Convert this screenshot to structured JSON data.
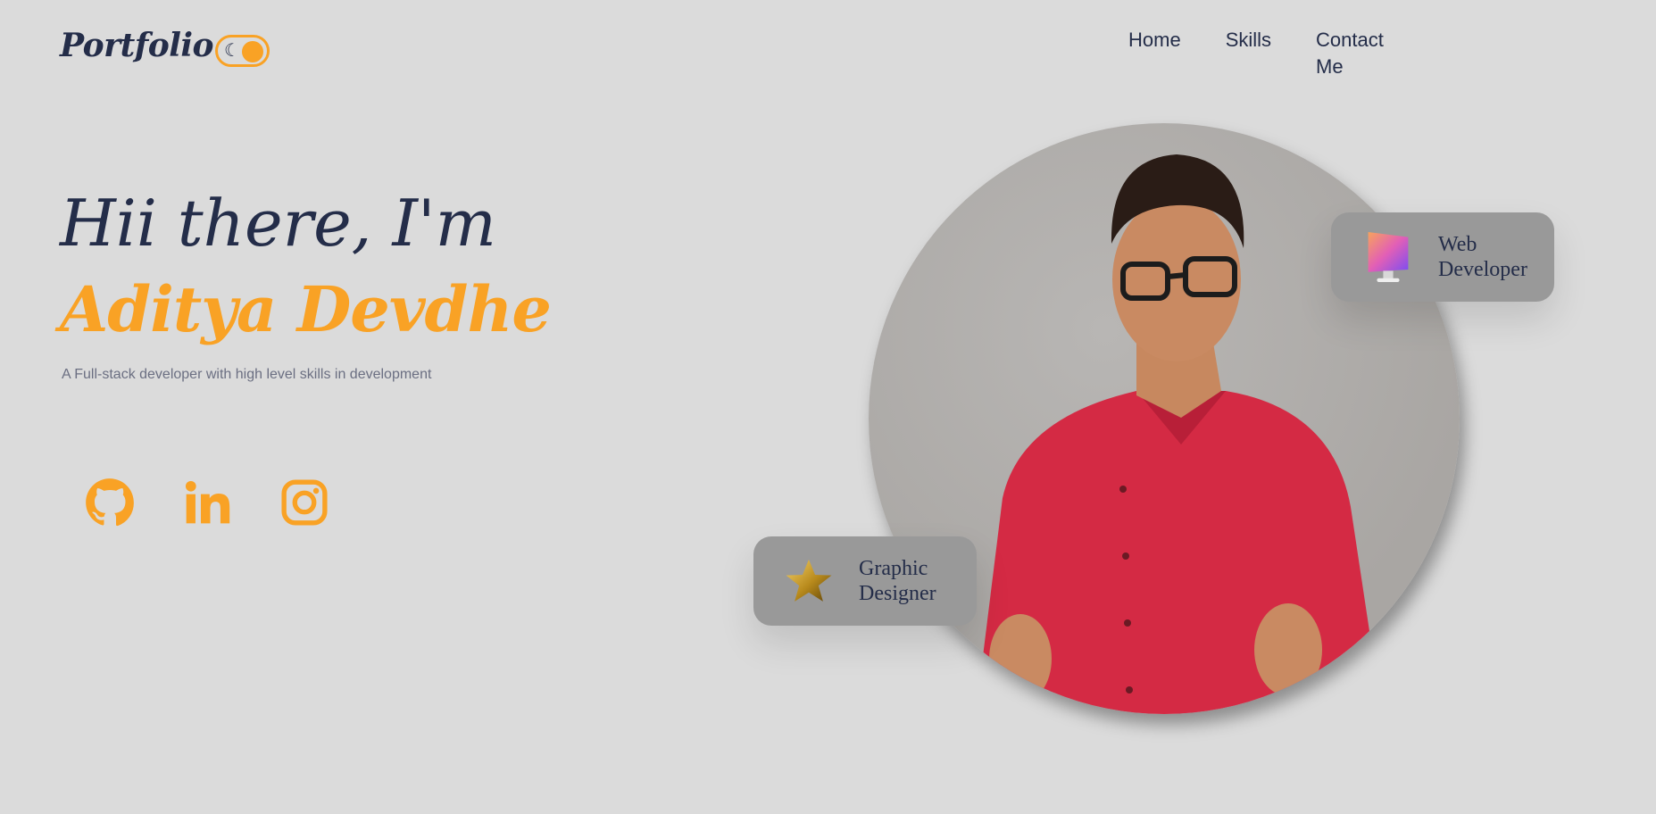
{
  "header": {
    "logo": "Portfolio",
    "theme_toggle": {
      "icon": "moon-icon",
      "state": "light"
    },
    "nav": [
      "Home",
      "Skills",
      "Contact Me"
    ]
  },
  "hero": {
    "greeting": "Hii there, I'm",
    "name": "Aditya Devdhe",
    "tagline": "A Full-stack developer with high level skills in development"
  },
  "socials": [
    {
      "icon": "github-icon"
    },
    {
      "icon": "linkedin-icon"
    },
    {
      "icon": "instagram-icon"
    }
  ],
  "badges": [
    {
      "icon": "monitor-icon",
      "line1": "Web",
      "line2": "Developer"
    },
    {
      "icon": "star-icon",
      "line1": "Graphic",
      "line2": "Designer"
    }
  ],
  "colors": {
    "background": "#dbdbdb",
    "accent": "#f9a225",
    "text": "#242d49",
    "card": "#999999"
  }
}
